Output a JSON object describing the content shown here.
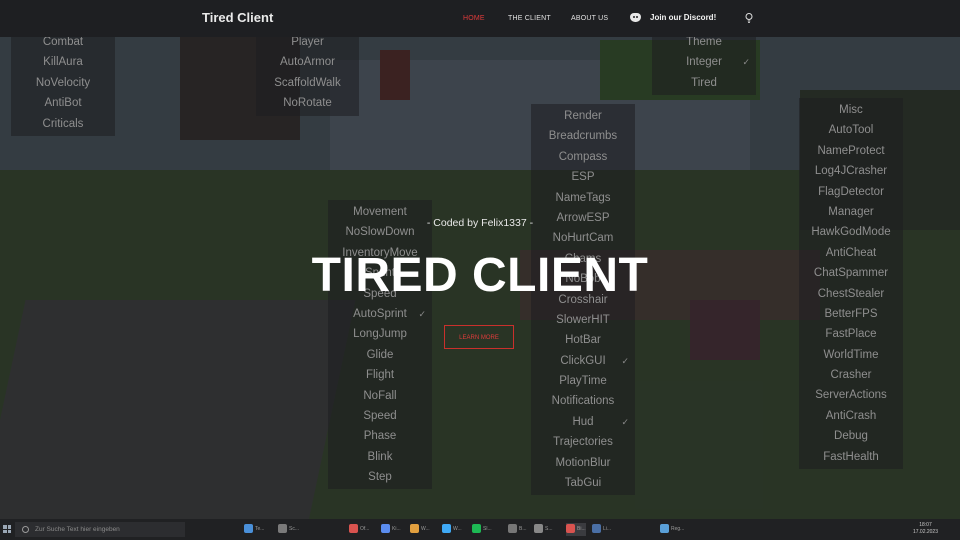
{
  "nav": {
    "brand": "Tired Client",
    "links": [
      "HOME",
      "THE CLIENT",
      "ABOUT US"
    ],
    "discord_label": "Join our Discord!",
    "active_color": "#e03b3b"
  },
  "hero": {
    "subtitle": "- Coded by Felix1337 -",
    "title": "TIRED CLIENT",
    "button": "LEARN MORE"
  },
  "panels": {
    "combat": [
      "Combat",
      "KillAura",
      "NoVelocity",
      "AntiBot",
      "Criticals"
    ],
    "player": [
      "Player",
      "AutoArmor",
      "ScaffoldWalk",
      "NoRotate"
    ],
    "theme": [
      "Theme",
      "Integer",
      "Tired"
    ],
    "render": [
      "Render",
      "Breadcrumbs",
      "Compass",
      "ESP",
      "NameTags",
      "ArrowESP",
      "NoHurtCam",
      "Chams",
      "NoBob",
      "Crosshair",
      "SlowerHIT",
      "HotBar",
      "ClickGUI",
      "PlayTime",
      "Notifications",
      "Hud",
      "Trajectories",
      "MotionBlur",
      "TabGui"
    ],
    "movement": [
      "Movement",
      "NoSlowDown",
      "InventoryMove",
      "Sprint",
      "Speed",
      "AutoSprint",
      "LongJump",
      "Glide",
      "Flight",
      "NoFall",
      "Speed",
      "Phase",
      "Blink",
      "Step"
    ],
    "misc": [
      "Misc",
      "AutoTool",
      "NameProtect",
      "Log4JCrasher",
      "FlagDetector",
      "Manager",
      "HawkGodMode",
      "AntiCheat",
      "ChatSpammer",
      "ChestStealer",
      "BetterFPS",
      "FastPlace",
      "WorldTime",
      "Crasher",
      "ServerActions",
      "AntiCrash",
      "Debug",
      "FastHealth"
    ]
  },
  "taskbar": {
    "search_placeholder": "Zur Suche Text hier eingeben",
    "apps": [
      "Te...",
      "Sc...",
      "Of...",
      "Ki...",
      "W...",
      "W...",
      "Sl...",
      "B...",
      "S...",
      "Bi...",
      "Li...",
      "Reg..."
    ],
    "time": "18:07",
    "date": "17.02.2023"
  }
}
